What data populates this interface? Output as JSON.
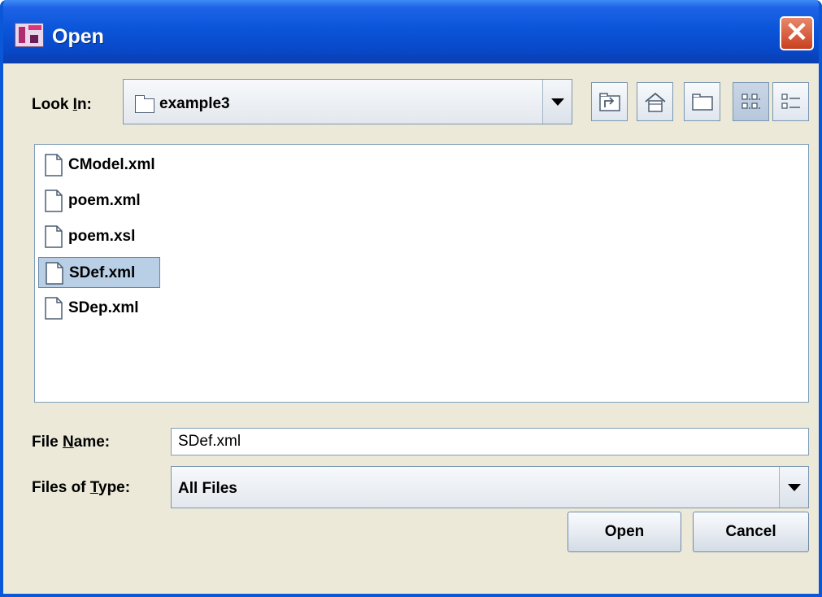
{
  "window": {
    "title": "Open",
    "app_icon": "app-icon",
    "close_icon": "close-icon"
  },
  "look_in": {
    "label_prefix": "Look ",
    "label_mnemonic": "I",
    "label_suffix": "n:",
    "value": "example3",
    "icon": "folder-icon"
  },
  "toolbar": [
    {
      "name": "up-one-level-button",
      "icon": "folder-up-icon"
    },
    {
      "name": "home-button",
      "icon": "home-icon"
    },
    {
      "name": "new-folder-button",
      "icon": "new-folder-icon"
    },
    {
      "name": "list-view-button",
      "icon": "list-view-icon",
      "pressed": true
    },
    {
      "name": "details-view-button",
      "icon": "details-view-icon",
      "pressed": false
    }
  ],
  "files": [
    {
      "name": "CModel.xml",
      "selected": false,
      "icon": "file-icon"
    },
    {
      "name": "poem.xml",
      "selected": false,
      "icon": "file-icon"
    },
    {
      "name": "poem.xsl",
      "selected": false,
      "icon": "file-icon"
    },
    {
      "name": "SDef.xml",
      "selected": true,
      "icon": "file-icon"
    },
    {
      "name": "SDep.xml",
      "selected": false,
      "icon": "file-icon"
    }
  ],
  "file_name": {
    "label_prefix": "File ",
    "label_mnemonic": "N",
    "label_suffix": "ame:",
    "value": "SDef.xml"
  },
  "file_type": {
    "label_prefix": "Files of ",
    "label_mnemonic": "T",
    "label_suffix": "ype:",
    "value": "All Files"
  },
  "buttons": {
    "open": "Open",
    "cancel": "Cancel"
  },
  "colors": {
    "titlebar": "#0a55da",
    "dialog_bg": "#ece9d8",
    "selection": "#b8cfe5",
    "close_button": "#d9542f"
  }
}
